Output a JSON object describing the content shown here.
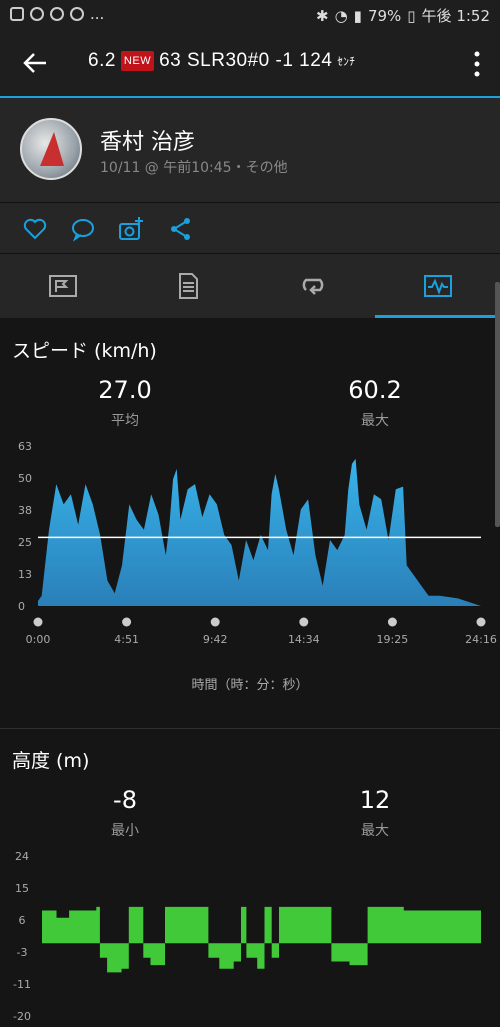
{
  "status_bar": {
    "battery": "79%",
    "time": "午後 1:52",
    "left_more": "..."
  },
  "app_bar": {
    "title_a": "6.2",
    "new_badge": "NEW",
    "title_b": "63  SLR30#0  -1  124",
    "title_suffix": "ｾﾝﾁ"
  },
  "profile": {
    "name": "香村 治彦",
    "meta": "10/11 @ 午前10:45・その他"
  },
  "actions": [
    "heart-icon",
    "comment-icon",
    "camera-add-icon",
    "share-icon"
  ],
  "tabs": [
    {
      "name": "summary",
      "icon": "flag-card-icon",
      "active": false
    },
    {
      "name": "details",
      "icon": "document-icon",
      "active": false
    },
    {
      "name": "laps",
      "icon": "loop-icon",
      "active": false
    },
    {
      "name": "charts",
      "icon": "pulse-chart-icon",
      "active": true
    }
  ],
  "speed": {
    "title": "スピード (km/h)",
    "avg_value": "27.0",
    "avg_label": "平均",
    "max_value": "60.2",
    "max_label": "最大",
    "axis_title": "時間（時：分：秒）",
    "chart_data": {
      "type": "area",
      "y_ticks": [
        "63",
        "50",
        "38",
        "25",
        "13",
        "0"
      ],
      "ylim": [
        0,
        63
      ],
      "x_ticks": [
        "0:00",
        "4:51",
        "9:42",
        "14:34",
        "19:25",
        "24:16"
      ],
      "reference_line": 27.0,
      "color": "#2f9fd6",
      "profile": [
        [
          0,
          2
        ],
        [
          0.2,
          4
        ],
        [
          0.6,
          30
        ],
        [
          1.0,
          48
        ],
        [
          1.4,
          40
        ],
        [
          1.8,
          44
        ],
        [
          2.2,
          32
        ],
        [
          2.6,
          48
        ],
        [
          3.0,
          40
        ],
        [
          3.4,
          28
        ],
        [
          3.8,
          10
        ],
        [
          4.2,
          5
        ],
        [
          4.6,
          16
        ],
        [
          5.0,
          40
        ],
        [
          5.4,
          34
        ],
        [
          5.8,
          30
        ],
        [
          6.2,
          44
        ],
        [
          6.6,
          36
        ],
        [
          7.0,
          20
        ],
        [
          7.2,
          32
        ],
        [
          7.4,
          50
        ],
        [
          7.6,
          54
        ],
        [
          7.8,
          34
        ],
        [
          8.2,
          46
        ],
        [
          8.6,
          48
        ],
        [
          9.0,
          35
        ],
        [
          9.4,
          44
        ],
        [
          9.8,
          40
        ],
        [
          10.2,
          28
        ],
        [
          10.6,
          24
        ],
        [
          11.0,
          10
        ],
        [
          11.4,
          26
        ],
        [
          11.8,
          18
        ],
        [
          12.2,
          28
        ],
        [
          12.6,
          22
        ],
        [
          12.8,
          44
        ],
        [
          13.0,
          52
        ],
        [
          13.2,
          46
        ],
        [
          13.6,
          30
        ],
        [
          14.0,
          20
        ],
        [
          14.4,
          38
        ],
        [
          14.8,
          42
        ],
        [
          15.2,
          20
        ],
        [
          15.6,
          8
        ],
        [
          16.0,
          26
        ],
        [
          16.4,
          22
        ],
        [
          16.8,
          28
        ],
        [
          17.0,
          46
        ],
        [
          17.2,
          56
        ],
        [
          17.4,
          58
        ],
        [
          17.6,
          40
        ],
        [
          18.0,
          30
        ],
        [
          18.4,
          44
        ],
        [
          18.8,
          42
        ],
        [
          19.2,
          26
        ],
        [
          19.6,
          46
        ],
        [
          20.0,
          47
        ],
        [
          20.2,
          16
        ],
        [
          20.6,
          12
        ],
        [
          21.0,
          8
        ],
        [
          21.4,
          4
        ],
        [
          22.0,
          4
        ],
        [
          23.0,
          3
        ],
        [
          24.27,
          0
        ]
      ]
    }
  },
  "altitude": {
    "title": "高度 (m)",
    "min_value": "-8",
    "min_label": "最小",
    "max_value": "12",
    "max_label": "最大",
    "chart_data": {
      "type": "bar",
      "y_ticks": [
        "24",
        "15",
        "6",
        "-3",
        "-11",
        "-20"
      ],
      "ylim": [
        -20,
        24
      ],
      "color": "#41c93a",
      "profile": [
        [
          0,
          9
        ],
        [
          0.8,
          7
        ],
        [
          1.5,
          9
        ],
        [
          3.0,
          10
        ],
        [
          3.2,
          -4
        ],
        [
          3.6,
          -8
        ],
        [
          4.4,
          -7
        ],
        [
          4.8,
          10
        ],
        [
          5.6,
          -4
        ],
        [
          6.0,
          -6
        ],
        [
          6.4,
          -6
        ],
        [
          6.8,
          10
        ],
        [
          9.0,
          10
        ],
        [
          9.2,
          -4
        ],
        [
          9.8,
          -7
        ],
        [
          10.6,
          -5
        ],
        [
          11.0,
          10
        ],
        [
          11.3,
          -4
        ],
        [
          11.9,
          -7
        ],
        [
          12.3,
          10
        ],
        [
          12.7,
          -4
        ],
        [
          13.1,
          10
        ],
        [
          14.0,
          10
        ],
        [
          16.0,
          -5
        ],
        [
          17.0,
          -6
        ],
        [
          18.0,
          10
        ],
        [
          20.0,
          9
        ],
        [
          22.0,
          9
        ],
        [
          24.27,
          9
        ]
      ]
    }
  }
}
